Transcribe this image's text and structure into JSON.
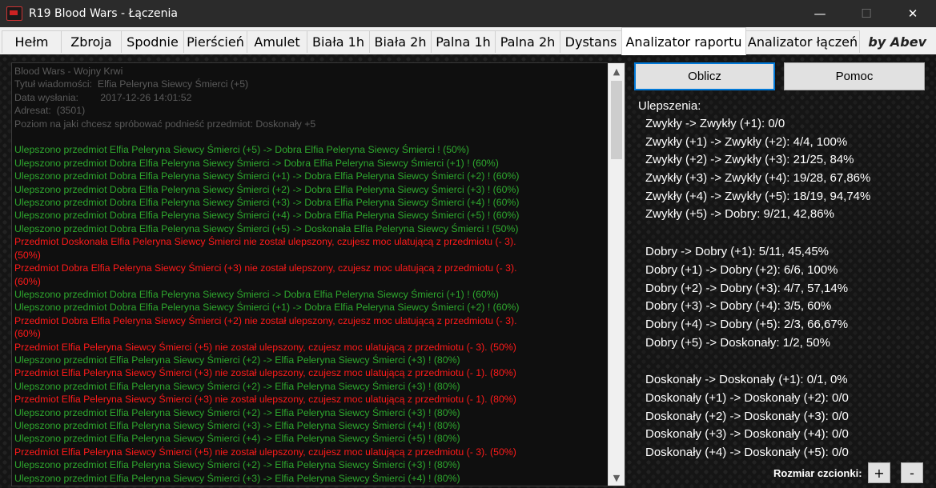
{
  "window": {
    "title": "R19 Blood Wars - Łączenia",
    "minimize": "—",
    "maximize": "☐",
    "close": "✕"
  },
  "tabs": [
    "Hełm",
    "Zbroja",
    "Spodnie",
    "Pierścień",
    "Amulet",
    "Biała 1h",
    "Biała 2h",
    "Palna 1h",
    "Palna 2h",
    "Dystans",
    "Analizator raportu",
    "Analizator łączeń"
  ],
  "active_tab": "Analizator raportu",
  "byline": "by Abev",
  "report": {
    "header_lines": [
      "Blood Wars - Wojny Krwi",
      "Tytuł wiadomości:  Elfia Peleryna Siewcy Śmierci (+5)",
      "Data wysłania:        2017-12-26 14:01:52",
      "Adresat:  (3501)",
      "Poziom na jaki chcesz spróbować podnieść przedmiot: Doskonały +5",
      ""
    ],
    "log_lines": [
      {
        "c": "green",
        "t": "Ulepszono przedmiot Elfia Peleryna Siewcy Śmierci (+5) -> Dobra Elfia Peleryna Siewcy Śmierci ! (50%)"
      },
      {
        "c": "green",
        "t": "Ulepszono przedmiot Dobra Elfia Peleryna Siewcy Śmierci -> Dobra Elfia Peleryna Siewcy Śmierci (+1) ! (60%)"
      },
      {
        "c": "green",
        "t": "Ulepszono przedmiot Dobra Elfia Peleryna Siewcy Śmierci (+1) -> Dobra Elfia Peleryna Siewcy Śmierci (+2) ! (60%)"
      },
      {
        "c": "green",
        "t": "Ulepszono przedmiot Dobra Elfia Peleryna Siewcy Śmierci (+2) -> Dobra Elfia Peleryna Siewcy Śmierci (+3) ! (60%)"
      },
      {
        "c": "green",
        "t": "Ulepszono przedmiot Dobra Elfia Peleryna Siewcy Śmierci (+3) -> Dobra Elfia Peleryna Siewcy Śmierci (+4) ! (60%)"
      },
      {
        "c": "green",
        "t": "Ulepszono przedmiot Dobra Elfia Peleryna Siewcy Śmierci (+4) -> Dobra Elfia Peleryna Siewcy Śmierci (+5) ! (60%)"
      },
      {
        "c": "green",
        "t": "Ulepszono przedmiot Dobra Elfia Peleryna Siewcy Śmierci (+5) -> Doskonała Elfia Peleryna Siewcy Śmierci ! (50%)"
      },
      {
        "c": "red",
        "t": "Przedmiot Doskonała Elfia Peleryna Siewcy Śmierci nie został ulepszony, czujesz moc ulatującą z przedmiotu (- 3)."
      },
      {
        "c": "red",
        "t": "(50%)"
      },
      {
        "c": "red",
        "t": "Przedmiot Dobra Elfia Peleryna Siewcy Śmierci (+3) nie został ulepszony, czujesz moc ulatującą z przedmiotu (- 3)."
      },
      {
        "c": "red",
        "t": "(60%)"
      },
      {
        "c": "green",
        "t": "Ulepszono przedmiot Dobra Elfia Peleryna Siewcy Śmierci -> Dobra Elfia Peleryna Siewcy Śmierci (+1) ! (60%)"
      },
      {
        "c": "green",
        "t": "Ulepszono przedmiot Dobra Elfia Peleryna Siewcy Śmierci (+1) -> Dobra Elfia Peleryna Siewcy Śmierci (+2) ! (60%)"
      },
      {
        "c": "red",
        "t": "Przedmiot Dobra Elfia Peleryna Siewcy Śmierci (+2) nie został ulepszony, czujesz moc ulatującą z przedmiotu (- 3)."
      },
      {
        "c": "red",
        "t": "(60%)"
      },
      {
        "c": "red",
        "t": "Przedmiot Elfia Peleryna Siewcy Śmierci (+5) nie został ulepszony, czujesz moc ulatującą z przedmiotu (- 3). (50%)"
      },
      {
        "c": "green",
        "t": "Ulepszono przedmiot Elfia Peleryna Siewcy Śmierci (+2) -> Elfia Peleryna Siewcy Śmierci (+3) ! (80%)"
      },
      {
        "c": "red",
        "t": "Przedmiot Elfia Peleryna Siewcy Śmierci (+3) nie został ulepszony, czujesz moc ulatującą z przedmiotu (- 1). (80%)"
      },
      {
        "c": "green",
        "t": "Ulepszono przedmiot Elfia Peleryna Siewcy Śmierci (+2) -> Elfia Peleryna Siewcy Śmierci (+3) ! (80%)"
      },
      {
        "c": "red",
        "t": "Przedmiot Elfia Peleryna Siewcy Śmierci (+3) nie został ulepszony, czujesz moc ulatującą z przedmiotu (- 1). (80%)"
      },
      {
        "c": "green",
        "t": "Ulepszono przedmiot Elfia Peleryna Siewcy Śmierci (+2) -> Elfia Peleryna Siewcy Śmierci (+3) ! (80%)"
      },
      {
        "c": "green",
        "t": "Ulepszono przedmiot Elfia Peleryna Siewcy Śmierci (+3) -> Elfia Peleryna Siewcy Śmierci (+4) ! (80%)"
      },
      {
        "c": "green",
        "t": "Ulepszono przedmiot Elfia Peleryna Siewcy Śmierci (+4) -> Elfia Peleryna Siewcy Śmierci (+5) ! (80%)"
      },
      {
        "c": "red",
        "t": "Przedmiot Elfia Peleryna Siewcy Śmierci (+5) nie został ulepszony, czujesz moc ulatującą z przedmiotu (- 3). (50%)"
      },
      {
        "c": "green",
        "t": "Ulepszono przedmiot Elfia Peleryna Siewcy Śmierci (+2) -> Elfia Peleryna Siewcy Śmierci (+3) ! (80%)"
      },
      {
        "c": "green",
        "t": "Ulepszono przedmiot Elfia Peleryna Siewcy Śmierci (+3) -> Elfia Peleryna Siewcy Śmierci (+4) ! (80%)"
      }
    ]
  },
  "buttons": {
    "compute": "Oblicz",
    "help": "Pomoc",
    "font_plus": "+",
    "font_minus": "-"
  },
  "stats": {
    "title": "Ulepszenia:",
    "groups": [
      [
        "Zwykły -> Zwykły (+1): 0/0",
        "Zwykły (+1) -> Zwykły (+2): 4/4, 100%",
        "Zwykły (+2) -> Zwykły (+3): 21/25, 84%",
        "Zwykły (+3) -> Zwykły (+4): 19/28, 67,86%",
        "Zwykły (+4) -> Zwykły (+5): 18/19, 94,74%",
        "Zwykły (+5) -> Dobry: 9/21, 42,86%"
      ],
      [
        "Dobry -> Dobry (+1): 5/11, 45,45%",
        "Dobry (+1) -> Dobry (+2): 6/6, 100%",
        "Dobry (+2) -> Dobry (+3): 4/7, 57,14%",
        "Dobry (+3) -> Dobry (+4): 3/5, 60%",
        "Dobry (+4) -> Dobry (+5): 2/3, 66,67%",
        "Dobry (+5) -> Doskonały: 1/2, 50%"
      ],
      [
        "Doskonały -> Doskonały (+1): 0/1, 0%",
        "Doskonały (+1) -> Doskonały (+2): 0/0",
        "Doskonały (+2) -> Doskonały (+3): 0/0",
        "Doskonały (+3) -> Doskonały (+4): 0/0",
        "Doskonały (+4) -> Doskonały (+5): 0/0"
      ]
    ]
  },
  "font_size_label": "Rozmiar czcionki:",
  "colors": {
    "success": "#2ea82e",
    "failure": "#ff1a1a",
    "meta": "#5a5a5a",
    "accent": "#0078d7"
  },
  "icons": {
    "scroll_up": "▲",
    "scroll_down": "▼"
  }
}
